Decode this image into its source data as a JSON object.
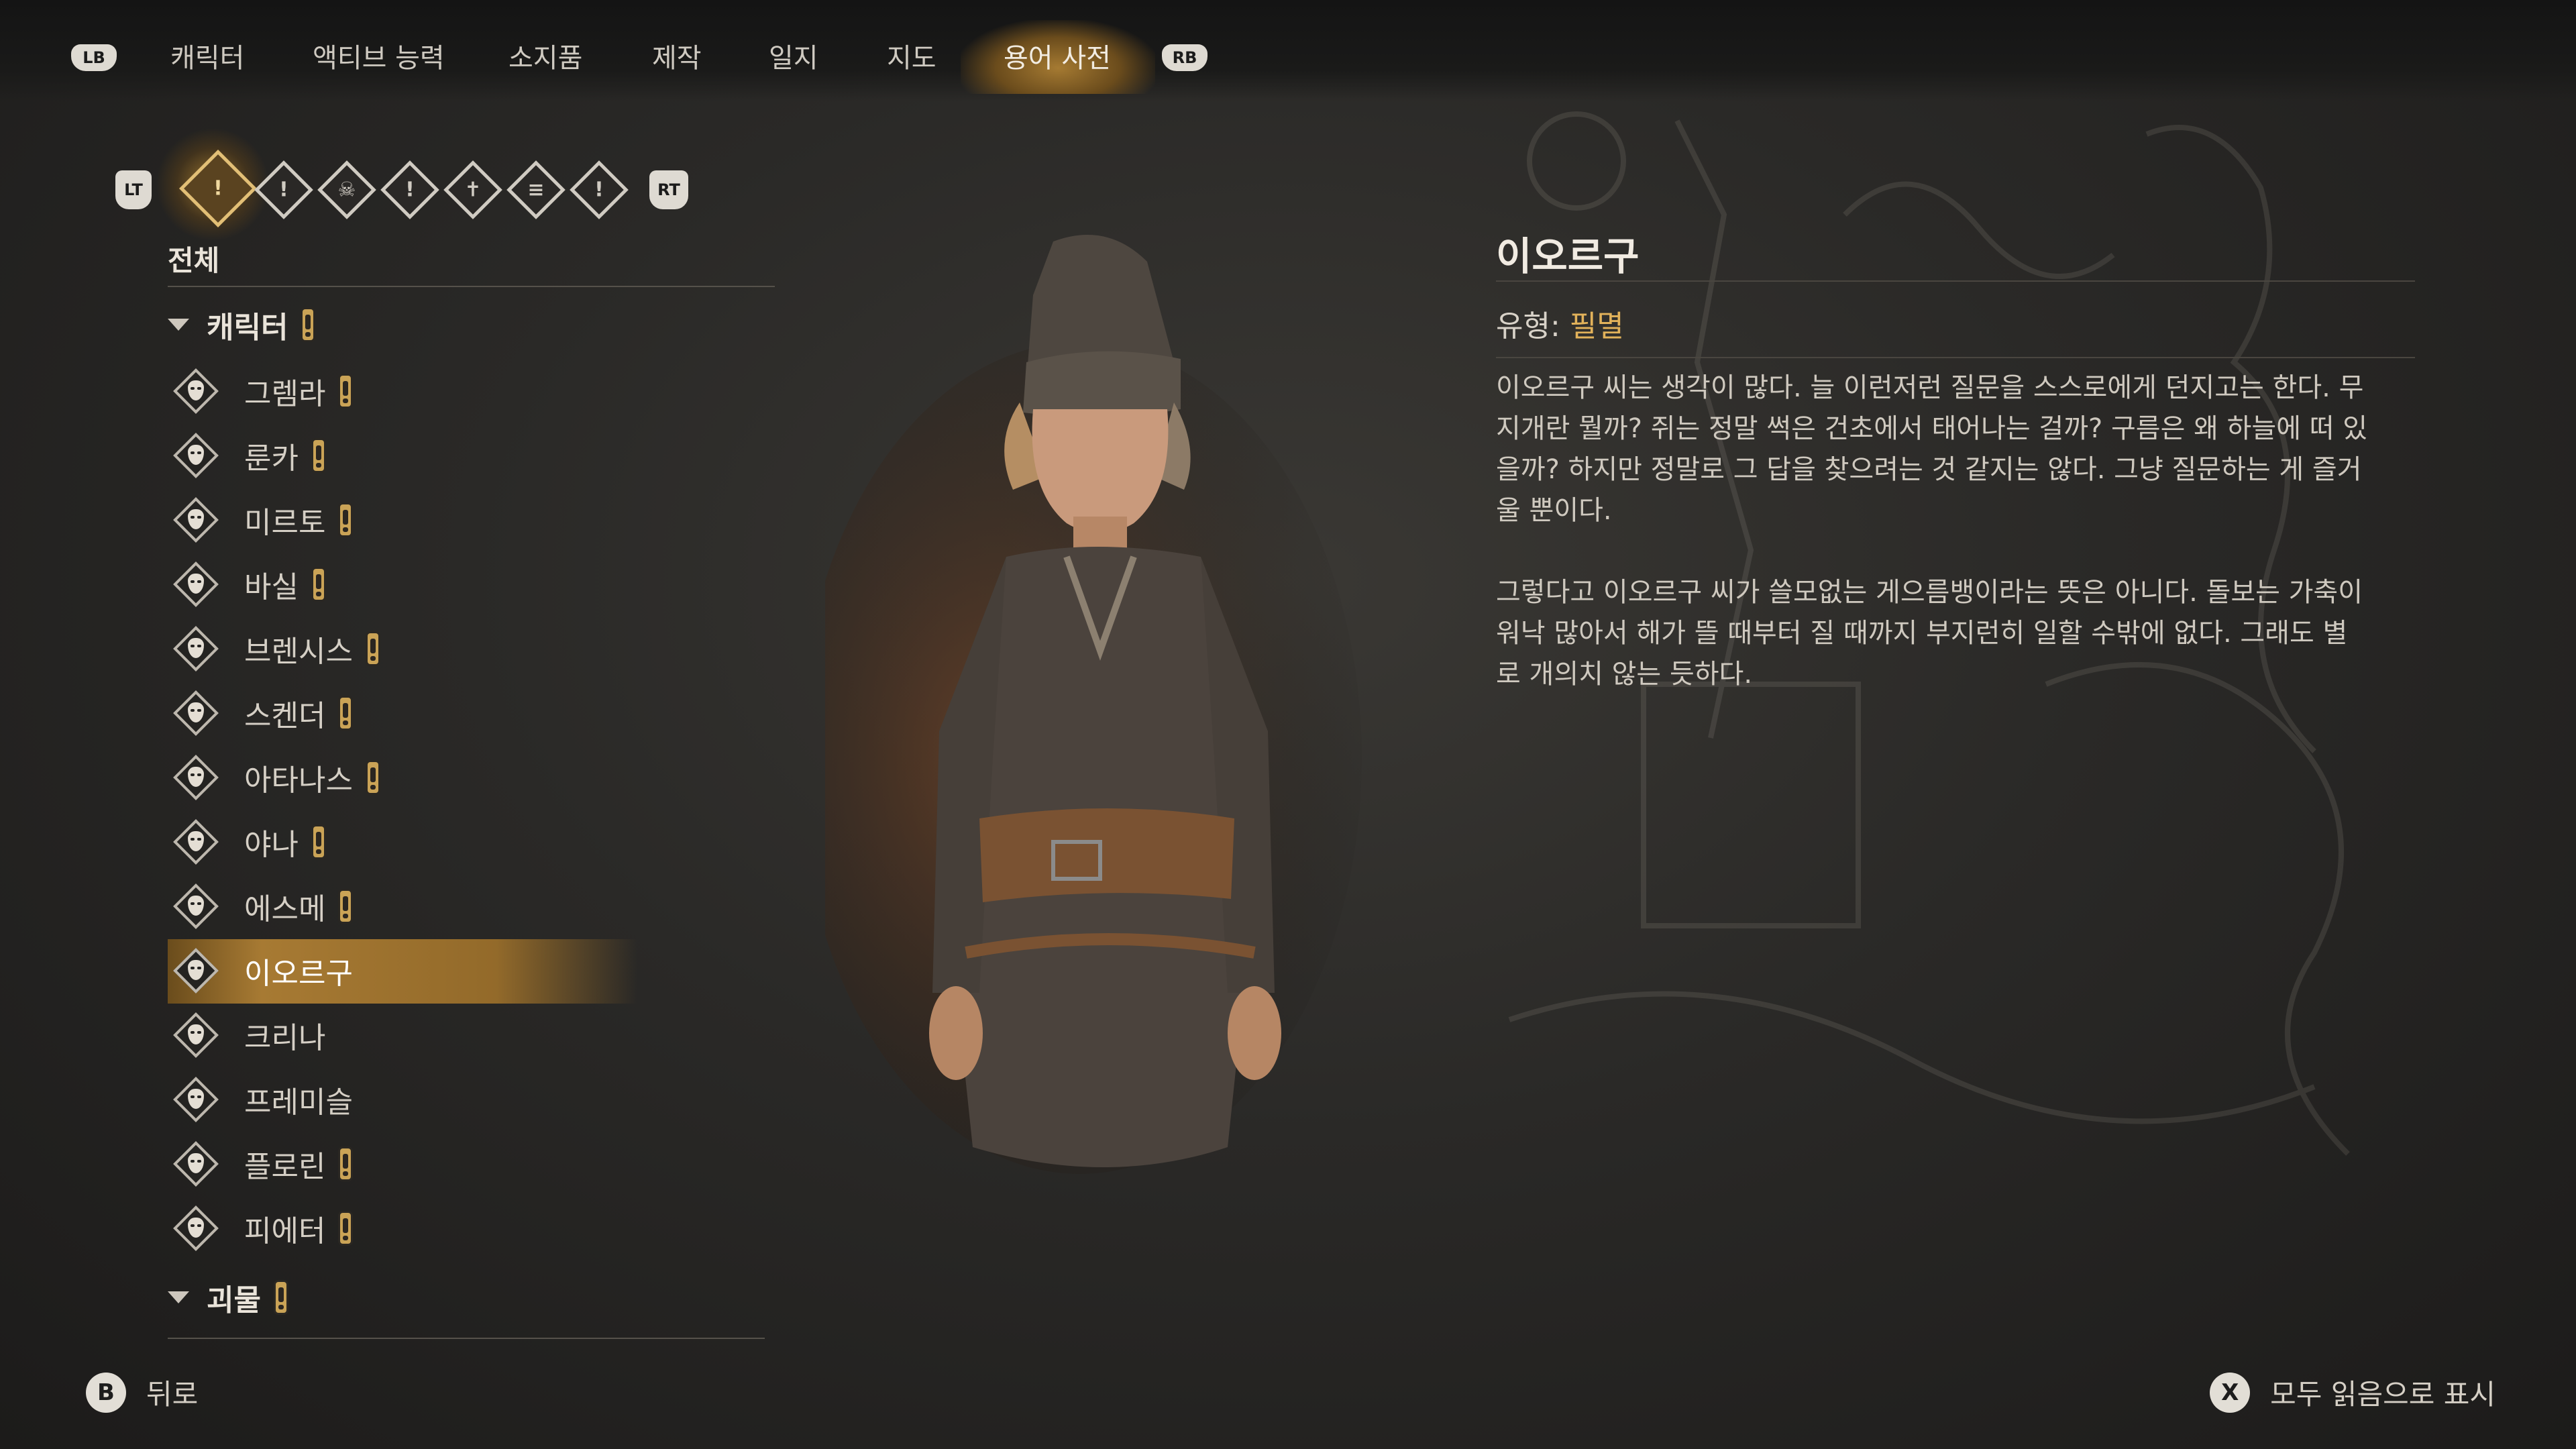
{
  "tabs": {
    "lb": "LB",
    "rb": "RB",
    "items": [
      "캐릭터",
      "액티브 능력",
      "소지품",
      "제작",
      "일지",
      "지도",
      "용어 사전"
    ],
    "active_index": 6
  },
  "filters": {
    "lt": "LT",
    "rt": "RT",
    "icons": [
      "all-filter-icon",
      "character-filter-icon",
      "monster-filter-icon",
      "faction-filter-icon",
      "place-filter-icon",
      "scroll-filter-icon",
      "misc-filter-icon"
    ],
    "active_index": 0
  },
  "list": {
    "section": "전체",
    "category_characters": "캐릭터",
    "category_monsters": "괴물",
    "items": [
      {
        "label": "그렘라",
        "unread": true
      },
      {
        "label": "룬카",
        "unread": true
      },
      {
        "label": "미르토",
        "unread": true
      },
      {
        "label": "바실",
        "unread": true
      },
      {
        "label": "브렌시스",
        "unread": true
      },
      {
        "label": "스켄더",
        "unread": true
      },
      {
        "label": "아타나스",
        "unread": true
      },
      {
        "label": "야나",
        "unread": true
      },
      {
        "label": "에스메",
        "unread": true
      },
      {
        "label": "이오르구",
        "unread": false,
        "selected": true
      },
      {
        "label": "크리나",
        "unread": false
      },
      {
        "label": "프레미슬",
        "unread": false
      },
      {
        "label": "플로린",
        "unread": true
      },
      {
        "label": "피에터",
        "unread": true
      }
    ]
  },
  "detail": {
    "title": "이오르구",
    "type_label": "유형:",
    "type_value": "필멸",
    "para1": "이오르구 씨는 생각이 많다. 늘 이런저런 질문을 스스로에게 던지고는 한다. 무지개란 뭘까? 쥐는 정말 썩은 건초에서 태어나는 걸까? 구름은 왜 하늘에 떠 있을까? 하지만 정말로 그 답을 찾으려는 것 같지는 않다. 그냥 질문하는 게 즐거울 뿐이다.",
    "para2": "그렇다고 이오르구 씨가 쓸모없는 게으름뱅이라는 뜻은 아니다. 돌보는 가축이 워낙 많아서 해가 뜰 때부터 질 때까지 부지런히 일할 수밖에 없다. 그래도 별로 개의치 않는 듯하다."
  },
  "footer": {
    "back_key": "B",
    "back_label": "뒤로",
    "mark_key": "X",
    "mark_label": "모두 읽음으로 표시"
  }
}
